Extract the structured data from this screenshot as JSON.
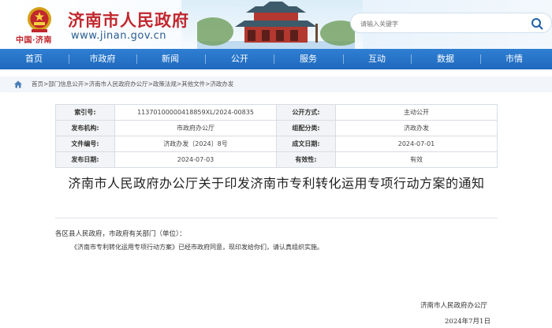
{
  "header": {
    "site_title": "济南市人民政府",
    "site_url": "www.jinan.gov.cn",
    "city_label": "中国·济南",
    "search_placeholder": "请输入关键字"
  },
  "nav": {
    "items": [
      "首页",
      "市政府",
      "新闻",
      "公开",
      "服务",
      "互动",
      "数据",
      "市情"
    ]
  },
  "breadcrumb": "首页>部门信息公开>济南市人民政府办公厅>政策法规>其他文件>济政办发",
  "info": {
    "rows": [
      {
        "k1": "索引号:",
        "v1": "11370100000418859XL/2024-00835",
        "k2": "公开方式:",
        "v2": "主动公开"
      },
      {
        "k1": "发布机构:",
        "v1": "市政府办公厅",
        "k2": "组配分类:",
        "v2": "济政办发"
      },
      {
        "k1": "文件编号:",
        "v1": "济政办发〔2024〕8号",
        "k2": "成文日期:",
        "v2": "2024-07-01"
      },
      {
        "k1": "发布日期:",
        "v1": "2024-07-03",
        "k2": "有效性:",
        "v2": "有效"
      }
    ]
  },
  "document": {
    "title": "济南市人民政府办公厅关于印发济南市专利转化运用专项行动方案的通知",
    "greeting": "各区县人民政府，市政府有关部门（单位）：",
    "body": "《济南市专利转化运用专项行动方案》已经市政府同意，现印发给你们，请认真组织实施。",
    "sign_org": "济南市人民政府办公厅",
    "sign_date": "2024年7月1日"
  },
  "colors": {
    "brand_red": "#c1272d",
    "nav_blue": "#2274c6",
    "url_blue": "#2a5d91"
  }
}
